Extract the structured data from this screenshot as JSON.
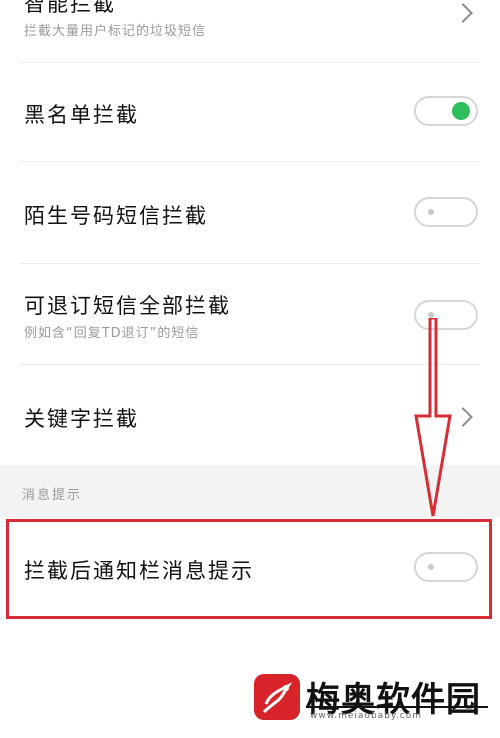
{
  "settings": {
    "smart_block": {
      "title": "智能拦截",
      "subtitle": "拦截大量用户标记的垃圾短信"
    },
    "blacklist": {
      "title": "黑名单拦截",
      "enabled": true
    },
    "stranger_sms": {
      "title": "陌生号码短信拦截",
      "enabled": false
    },
    "unsubscribe": {
      "title": "可退订短信全部拦截",
      "subtitle": "例如含“回复TD退订”的短信",
      "enabled": false
    },
    "keyword": {
      "title": "关键字拦截"
    }
  },
  "section": {
    "label": "消息提示"
  },
  "notify": {
    "title": "拦截后通知栏消息提示",
    "enabled": false
  },
  "watermark": {
    "brand": "梅奥软件园",
    "url": "www.meiaobaby.com"
  },
  "colors": {
    "toggle_on": "#2fbf5f",
    "highlight": "#d62e34"
  }
}
